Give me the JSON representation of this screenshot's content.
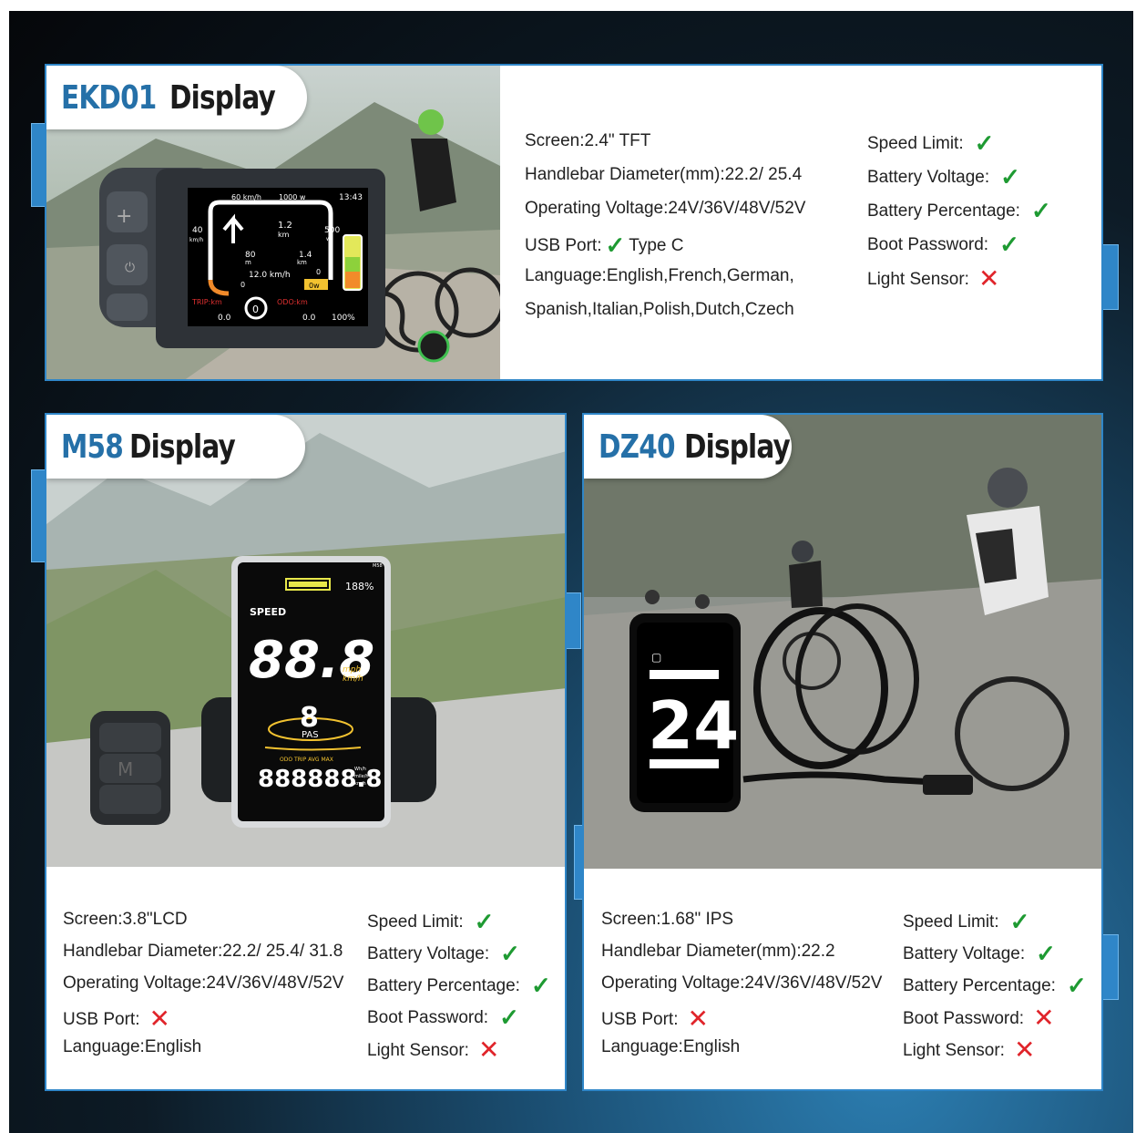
{
  "cards": [
    {
      "model": "EKD01",
      "title_word": "Display",
      "left_specs": [
        "Screen:2.4\" TFT",
        "Handlebar Diameter(mm):22.2/ 25.4",
        "Operating Voltage:24V/36V/48V/52V",
        "Language:English,French,German,",
        "Spanish,Italian,Polish,Dutch,Czech"
      ],
      "usb": {
        "label": "USB Port:",
        "status": "yes",
        "suffix": "Type C"
      },
      "features": [
        {
          "label": "Speed Limit:",
          "status": "yes"
        },
        {
          "label": "Battery Voltage:",
          "status": "yes"
        },
        {
          "label": "Battery Percentage:",
          "status": "yes"
        },
        {
          "label": "Boot Password:",
          "status": "yes"
        },
        {
          "label": "Light Sensor:",
          "status": "no"
        }
      ],
      "screen": {
        "speed_limit": "60 km/h",
        "power": "1000 w",
        "time": "13:43",
        "left_val": "40",
        "left_unit": "km/h",
        "dist1": "1.2",
        "dist1_unit": "km",
        "right_val": "500",
        "right_unit": "w",
        "dist2": "80",
        "dist2_unit": "m",
        "dist3": "1.4",
        "dist3_unit": "km",
        "speed_mid": "12.0 km/h",
        "zero_left": "0",
        "zero_right": "0",
        "watts": "0w",
        "trip_label": "TRIP:km",
        "odo_label": "ODO:km",
        "trip": "0.0",
        "assist": "0",
        "odo": "0.0",
        "battery": "100%"
      }
    },
    {
      "model": "M58",
      "title_word": "Display",
      "left_specs": [
        "Screen:3.8\"LCD",
        "Handlebar Diameter:22.2/ 25.4/ 31.8",
        "Operating Voltage:24V/36V/48V/52V",
        "Language:English"
      ],
      "usb": {
        "label": "USB Port:",
        "status": "no"
      },
      "features": [
        {
          "label": "Speed Limit:",
          "status": "yes"
        },
        {
          "label": "Battery Voltage:",
          "status": "yes"
        },
        {
          "label": "Battery Percentage:",
          "status": "yes"
        },
        {
          "label": "Boot Password:",
          "status": "yes"
        },
        {
          "label": "Light Sensor:",
          "status": "no"
        }
      ],
      "screen": {
        "model_tag": "M58",
        "battery": "188%",
        "speed_label": "SPEED",
        "speed": "88.8",
        "speed_unit1": "mph",
        "speed_unit2": "km/h",
        "pas_digit": "8",
        "pas_label": "PAS",
        "odo_labels": "ODO TRIP AVG MAX",
        "odo": "888888.8",
        "odo_unit1": "Wh/h",
        "odo_unit2": "mile/h",
        "odo_unit3": "km/h",
        "remote_key": "M"
      }
    },
    {
      "model": "DZ40",
      "title_word": "Display",
      "left_specs": [
        "Screen:1.68\" IPS",
        "Handlebar Diameter(mm):22.2",
        "Operating Voltage:24V/36V/48V/52V",
        "Language:English"
      ],
      "usb": {
        "label": "USB Port:",
        "status": "no"
      },
      "features": [
        {
          "label": "Speed Limit:",
          "status": "yes"
        },
        {
          "label": "Battery Voltage:",
          "status": "yes"
        },
        {
          "label": "Battery Percentage:",
          "status": "yes"
        },
        {
          "label": "Boot Password:",
          "status": "no"
        },
        {
          "label": "Light Sensor:",
          "status": "no"
        }
      ],
      "screen": {
        "speed": "24"
      }
    }
  ],
  "colors": {
    "accent_blue": "#2f86c8",
    "title_blue": "#2570a8",
    "check_green": "#1e9a32",
    "cross_red": "#e0242a"
  },
  "icons": {
    "yes": "check-icon",
    "no": "cross-icon"
  }
}
